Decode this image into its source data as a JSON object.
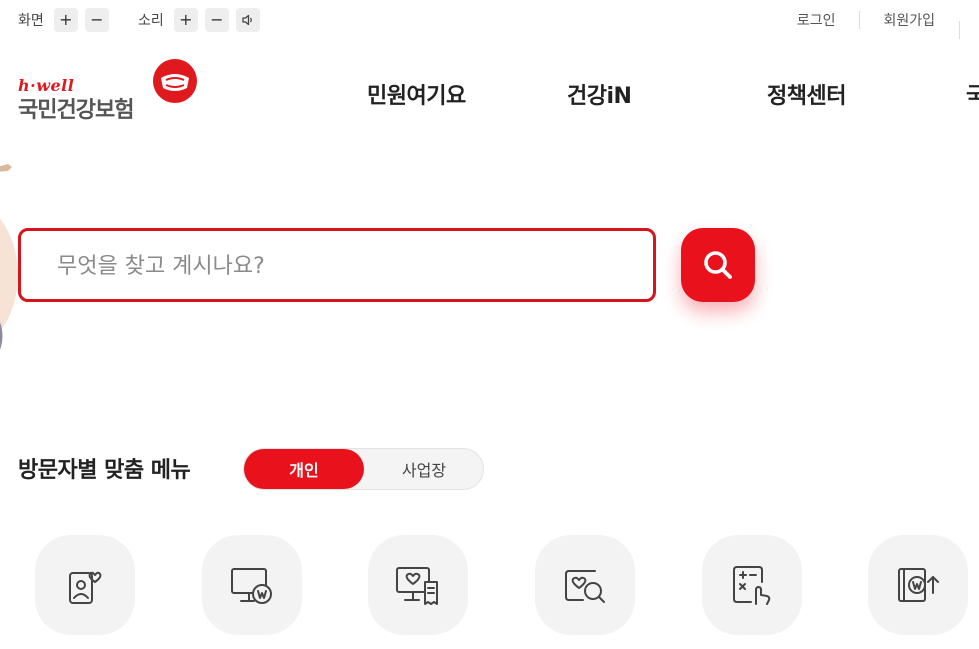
{
  "utility": {
    "screen_label": "화면",
    "sound_label": "소리",
    "plus": "+",
    "minus": "−",
    "login": "로그인",
    "signup": "회원가입"
  },
  "logo": {
    "brand": "h·well",
    "name": "국민건강보험"
  },
  "gnb": {
    "items": [
      "민원여기요",
      "건강iN",
      "정책센터",
      "국"
    ]
  },
  "search": {
    "placeholder": "무엇을 찾고 계시나요?",
    "value": ""
  },
  "visitor_menu": {
    "title": "방문자별 맞춤 메뉴",
    "toggle": [
      "개인",
      "사업장"
    ],
    "active": "개인"
  },
  "quick_icons": [
    "person-card-heart-icon",
    "monitor-won-icon",
    "monitor-heart-receipt-icon",
    "heart-search-icon",
    "calculator-hand-icon",
    "book-won-up-icon"
  ],
  "colors": {
    "accent": "#e8111c",
    "border_red": "#d7141b",
    "icon_bg": "#f3f3f4",
    "text_dark": "#222222"
  }
}
